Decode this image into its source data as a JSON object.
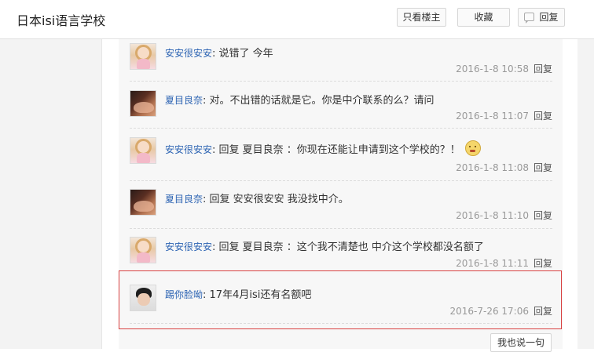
{
  "header": {
    "title": "日本isi语言学校",
    "buttons": {
      "only_host": "只看楼主",
      "favorite": "收藏",
      "reply": "回复"
    }
  },
  "comments": [
    {
      "user": "安安很安安",
      "text": "说错了 今年",
      "time": "2016-1-8 10:58",
      "reply": "回复",
      "avatar": "doll-avatar"
    },
    {
      "user": "夏目良奈",
      "text": "对。不出错的话就是它。你是中介联系的么？请问",
      "time": "2016-1-8 11:07",
      "reply": "回复",
      "avatar": "dark-avatar"
    },
    {
      "user": "安安很安安",
      "text": "回复 夏目良奈 ：你现在还能让申请到这个学校的？！",
      "time": "2016-1-8 11:08",
      "reply": "回复",
      "avatar": "doll-avatar",
      "emoji": "surprised-emoji"
    },
    {
      "user": "夏目良奈",
      "text": "回复 安安很安安 我没找中介。",
      "time": "2016-1-8 11:10",
      "reply": "回复",
      "avatar": "dark-avatar"
    },
    {
      "user": "安安很安安",
      "text": "回复 夏目良奈 ：这个我不清楚也 中介这个学校都没名额了",
      "time": "2016-1-8 11:11",
      "reply": "回复",
      "avatar": "doll-avatar"
    },
    {
      "user": "踢你脸呦",
      "text": "17年4月isi还有名额吧",
      "time": "2016-7-26 17:06",
      "reply": "回复",
      "avatar": "boy-avatar"
    }
  ],
  "footer": {
    "say_button": "我也说一句"
  },
  "colors": {
    "username": "#2d64b3",
    "highlight": "#d84040",
    "panel": "#f7f7f7"
  }
}
